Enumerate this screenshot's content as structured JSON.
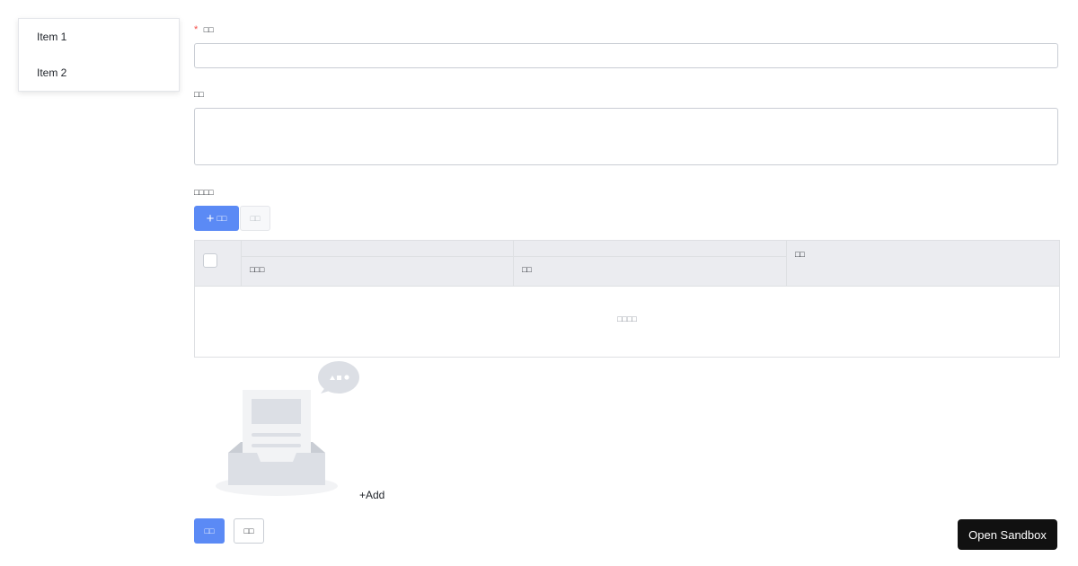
{
  "menu": {
    "items": [
      {
        "label": "Item 1"
      },
      {
        "label": "Item 2"
      }
    ]
  },
  "form": {
    "field1": {
      "required_mark": "*",
      "label": "□□",
      "value": ""
    },
    "field2": {
      "label": "□□",
      "value": ""
    },
    "field3": {
      "label": "□□□□"
    }
  },
  "toolbar": {
    "add_label": "□□",
    "delete_label": "□□"
  },
  "table": {
    "columns": [
      "□□□",
      "□□",
      "□□"
    ],
    "empty_text": "□□□□"
  },
  "add_link": "+Add",
  "actions": {
    "submit_label": "□□",
    "reset_label": "□□"
  },
  "sandbox_button": "Open Sandbox",
  "colors": {
    "primary": "#5b8af5",
    "required": "#f54a45",
    "header_bg": "#ebecf0",
    "sandbox_bg": "#111111"
  },
  "icons": {
    "add": "plus-icon",
    "empty": "empty-inbox-illustration",
    "checkbox": "checkbox"
  }
}
